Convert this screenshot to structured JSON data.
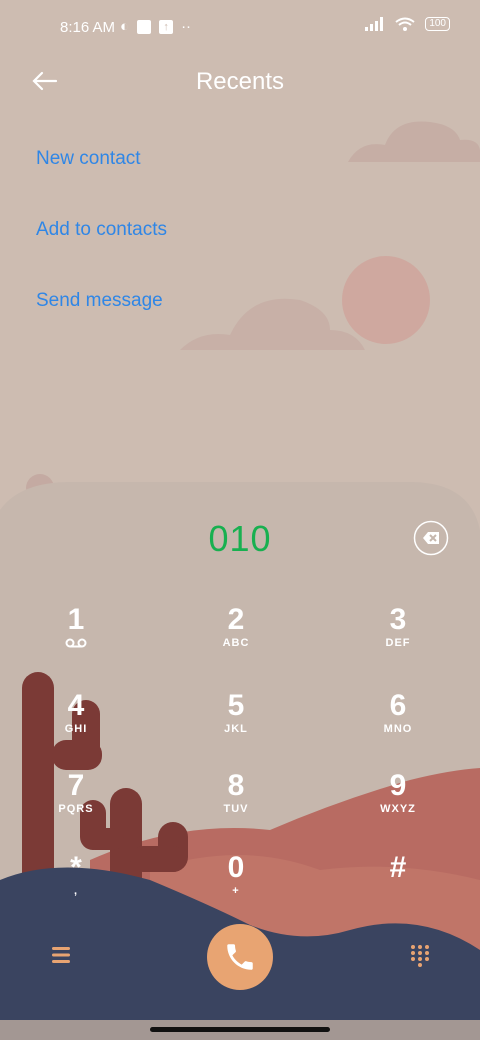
{
  "status_bar": {
    "time": "8:16 AM",
    "battery": "100"
  },
  "header": {
    "title": "Recents"
  },
  "actions": [
    {
      "label": "New contact"
    },
    {
      "label": "Add to contacts"
    },
    {
      "label": "Send message"
    }
  ],
  "dialer": {
    "number": "010",
    "keys": [
      {
        "digit": "1",
        "letters": ""
      },
      {
        "digit": "2",
        "letters": "ABC"
      },
      {
        "digit": "3",
        "letters": "DEF"
      },
      {
        "digit": "4",
        "letters": "GHI"
      },
      {
        "digit": "5",
        "letters": "JKL"
      },
      {
        "digit": "6",
        "letters": "MNO"
      },
      {
        "digit": "7",
        "letters": "PQRS"
      },
      {
        "digit": "8",
        "letters": "TUV"
      },
      {
        "digit": "9",
        "letters": "WXYZ"
      },
      {
        "digit": "*",
        "letters": ","
      },
      {
        "digit": "0",
        "letters": "+"
      },
      {
        "digit": "#",
        "letters": ""
      }
    ]
  },
  "colors": {
    "accent_link": "#2f86e6",
    "number_green": "#18b050",
    "call_button": "#e8a472"
  },
  "icons": [
    "back-arrow-icon",
    "delete-digit-icon",
    "voicemail-icon",
    "menu-icon",
    "phone-icon",
    "dialpad-icon"
  ]
}
